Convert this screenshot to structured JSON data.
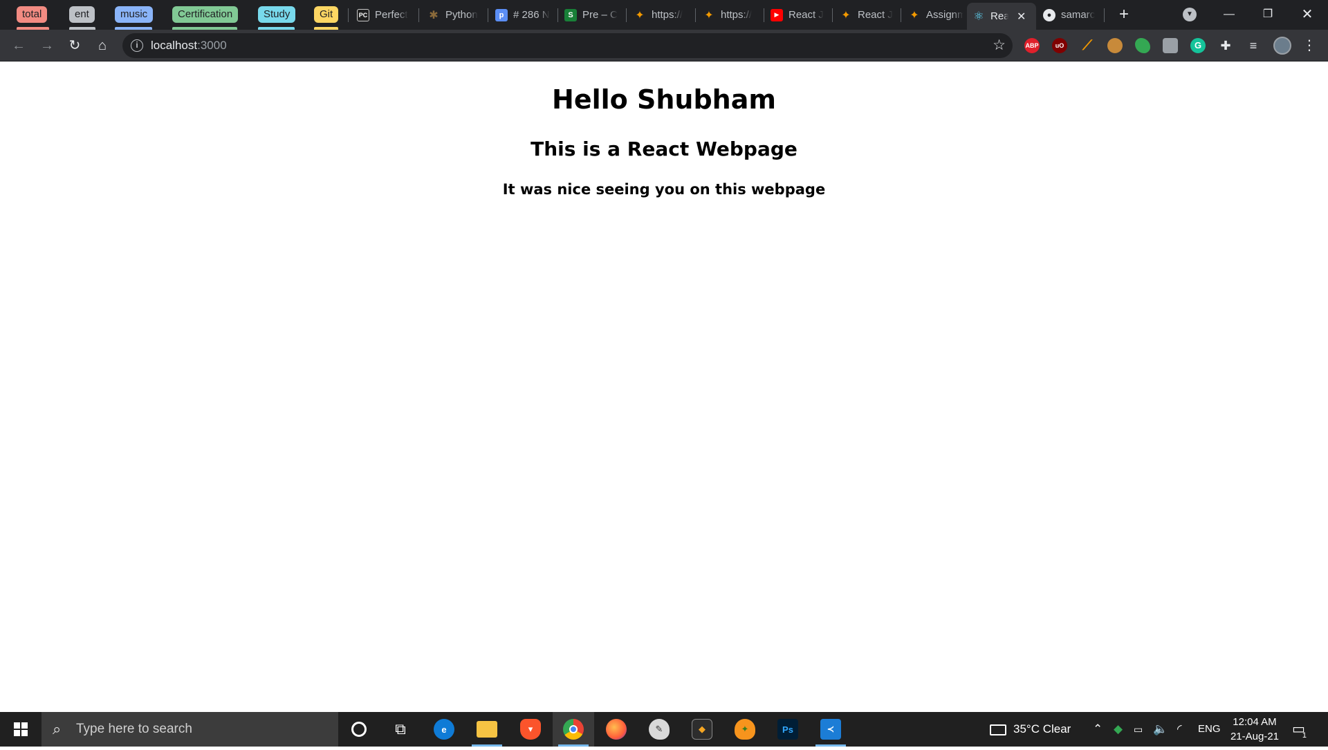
{
  "tab_groups": [
    {
      "label": "total",
      "color": "#f28b82"
    },
    {
      "label": "ent",
      "color": "#bdc1c6"
    },
    {
      "label": "music",
      "color": "#8ab4f8"
    },
    {
      "label": "Certification",
      "color": "#81c995"
    },
    {
      "label": "Study",
      "color": "#78d9ec"
    },
    {
      "label": "Git",
      "color": "#fdd663"
    }
  ],
  "tabs": [
    {
      "title": "Perfect",
      "favicon": "pycharm-icon"
    },
    {
      "title": "Python",
      "favicon": "gear-icon"
    },
    {
      "title": "# 286 N",
      "favicon": "p-icon"
    },
    {
      "title": "Pre – C",
      "favicon": "s-icon"
    },
    {
      "title": "https://",
      "favicon": "orange-icon"
    },
    {
      "title": "https://",
      "favicon": "orange-icon"
    },
    {
      "title": "React J",
      "favicon": "youtube-icon"
    },
    {
      "title": "React J",
      "favicon": "orange-icon"
    },
    {
      "title": "Assignm",
      "favicon": "orange-icon"
    },
    {
      "title": "Rea",
      "favicon": "react-icon",
      "active": true
    },
    {
      "title": "samarc",
      "favicon": "github-icon"
    }
  ],
  "address": {
    "host": "localhost",
    "port": ":3000"
  },
  "page": {
    "heading1": "Hello Shubham",
    "heading2": "This is a React Webpage",
    "heading3": "It was nice seeing you on this webpage"
  },
  "extensions": [
    {
      "name": "adblock-plus-icon",
      "label": "ABP",
      "color": "#e0202b"
    },
    {
      "name": "ublock-icon",
      "label": "uO",
      "color": "#800000"
    },
    {
      "name": "carrot-icon",
      "label": "",
      "color": "#f29900"
    },
    {
      "name": "cookie-icon",
      "label": "",
      "color": "#c88a3a"
    },
    {
      "name": "color-picker-icon",
      "label": "",
      "color": "#34a853"
    },
    {
      "name": "gray-ext-icon",
      "label": "",
      "color": "#9aa0a6"
    },
    {
      "name": "grammarly-icon",
      "label": "G",
      "color": "#15c39a"
    },
    {
      "name": "puzzle-icon",
      "label": "",
      "color": "transparent"
    },
    {
      "name": "media-control-icon",
      "label": "",
      "color": "transparent"
    }
  ],
  "taskbar": {
    "search_placeholder": "Type here to search",
    "apps": [
      "cortana-icon",
      "task-view-icon",
      "edge-icon",
      "file-explorer-icon",
      "brave-icon",
      "chrome-icon",
      "firefox-icon",
      "paint-icon",
      "davinci-icon",
      "fl-studio-icon",
      "photoshop-icon",
      "vscode-icon"
    ],
    "weather": "35°C  Clear",
    "lang": "ENG",
    "time": "12:04 AM",
    "date": "21-Aug-21",
    "notification_count": "1"
  }
}
